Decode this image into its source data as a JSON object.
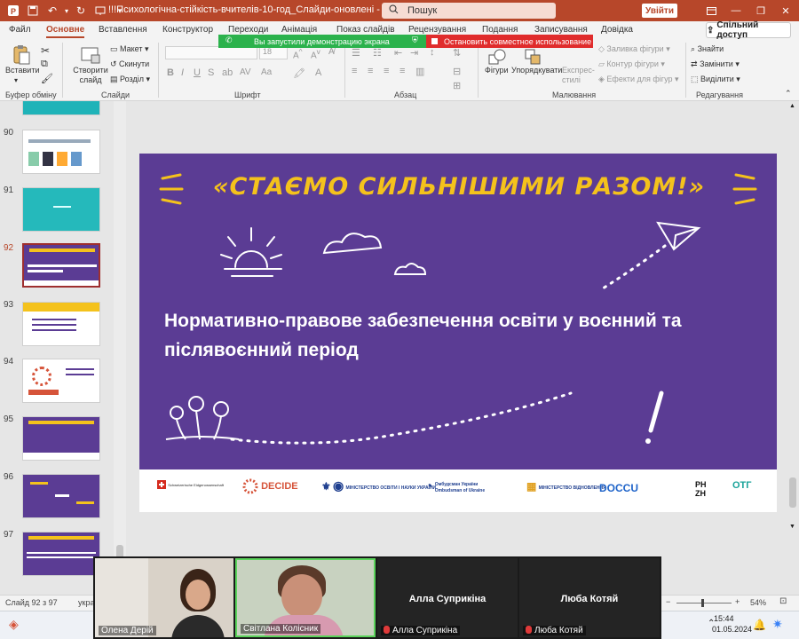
{
  "app": {
    "title": "!!!Психологічна-стійкість-вчителів-10-год_Слайди-оновлені - PowerPoint",
    "search_placeholder": "Пошук",
    "signin_label": "Увійти",
    "share_label": "Спільний доступ",
    "accent_color": "#b7472a"
  },
  "tabs": [
    "Файл",
    "Основне",
    "Вставлення",
    "Конструктор",
    "Переходи",
    "Анімація",
    "Показ слайдів",
    "Рецензування",
    "Подання",
    "Записування",
    "Довідка"
  ],
  "active_tab": "Основне",
  "screen_share": {
    "notice": "Вы запустили демонстрацию экрана",
    "stop_label": "Остановить совместное использование"
  },
  "ribbon": {
    "clipboard": {
      "paste": "Вставити",
      "label": "Буфер обміну"
    },
    "slides": {
      "new_slide": "Створити слайд",
      "layout": "Макет",
      "reset": "Скинути",
      "section": "Розділ",
      "label": "Слайди"
    },
    "font": {
      "size": "18",
      "label": "Шрифт"
    },
    "paragraph": {
      "label": "Абзац"
    },
    "drawing": {
      "shapes": "Фігури",
      "arrange": "Упорядкувати",
      "quick_styles": "Експрес-стилі",
      "fill": "Заливка фігури",
      "outline": "Контур фігури",
      "effects": "Ефекти для фігур",
      "label": "Малювання"
    },
    "editing": {
      "find": "Знайти",
      "replace": "Замінити",
      "select": "Виділити",
      "label": "Редагування"
    }
  },
  "thumbnails": [
    {
      "num": "90"
    },
    {
      "num": "91"
    },
    {
      "num": "92",
      "selected": true
    },
    {
      "num": "93"
    },
    {
      "num": "94"
    },
    {
      "num": "95"
    },
    {
      "num": "96"
    },
    {
      "num": "97"
    }
  ],
  "slide": {
    "heading": "«СТАЄМО СИЛЬНІШИМИ РАЗОМ!»",
    "body": "Нормативно-правове забезпечення освіти у воєнний та післявоєнний період",
    "logos": {
      "swiss": "Schweizerische Eidgenossenschaft",
      "decide": "DECIDE",
      "mon": "МІНІСТЕРСТВО ОСВІТИ І НАУКИ УКРАЇНИ",
      "ombudsman": "Омбудсман України",
      "ombudsman_en": "Ombudsman of Ukraine",
      "vidnovlennya": "МІНІСТЕРСТВО ВІДНОВЛЕННЯ",
      "docu": "DOCCU",
      "rnzh": "РН ZH",
      "otg": "ОТГ"
    },
    "purple": "#5b3c94",
    "yellow": "#f4c21c"
  },
  "status": {
    "slide_counter": "Слайд 92 з 97",
    "lang": "укра",
    "zoom": "54%"
  },
  "video": {
    "participants": [
      "Олена Дерій",
      "Світлана Колісник",
      "Алла Суприкіна",
      "Люба Котяй"
    ]
  },
  "taskbar": {
    "time": "15:44",
    "date": "01.05.2024"
  }
}
